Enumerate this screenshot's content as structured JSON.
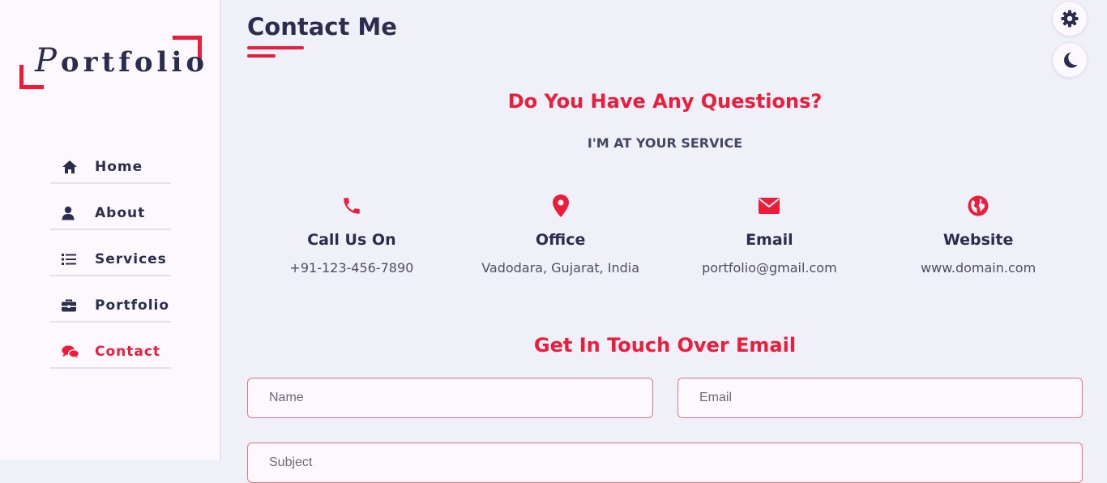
{
  "logo": {
    "initial": "P",
    "rest": "ortfolio"
  },
  "nav": {
    "items": [
      {
        "label": "Home",
        "icon": "home-icon"
      },
      {
        "label": "About",
        "icon": "user-icon"
      },
      {
        "label": "Services",
        "icon": "list-icon"
      },
      {
        "label": "Portfolio",
        "icon": "briefcase-icon"
      },
      {
        "label": "Contact",
        "icon": "chat-icon",
        "active": true
      }
    ]
  },
  "page": {
    "title": "Contact Me",
    "question_heading": "Do You Have Any Questions?",
    "subheading": "I'M AT YOUR SERVICE",
    "email_heading": "Get In Touch Over Email"
  },
  "contact_info": [
    {
      "title": "Call Us On",
      "value": "+91-123-456-7890",
      "icon": "phone-icon"
    },
    {
      "title": "Office",
      "value": "Vadodara, Gujarat, India",
      "icon": "location-pin-icon"
    },
    {
      "title": "Email",
      "value": "portfolio@gmail.com",
      "icon": "envelope-icon"
    },
    {
      "title": "Website",
      "value": "www.domain.com",
      "icon": "globe-icon"
    }
  ],
  "form": {
    "name_placeholder": "Name",
    "email_placeholder": "Email",
    "subject_placeholder": "Subject"
  },
  "controls": {
    "settings_icon": "gear-icon",
    "theme_icon": "moon-icon"
  },
  "colors": {
    "accent": "#ec1c3b",
    "text": "#2b2c4e",
    "background": "#eff0f8",
    "sidebar": "#fcf8fd"
  }
}
